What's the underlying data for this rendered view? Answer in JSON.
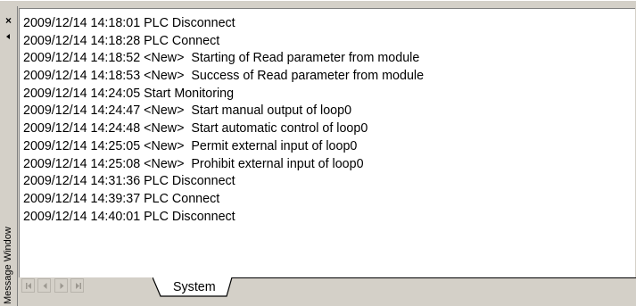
{
  "window": {
    "title": "Message Window",
    "close_glyph": "×"
  },
  "messages": [
    "2009/12/14 14:18:01 PLC Disconnect",
    "2009/12/14 14:18:28 PLC Connect",
    "2009/12/14 14:18:52 <New>  Starting of Read parameter from module",
    "2009/12/14 14:18:53 <New>  Success of Read parameter from module",
    "2009/12/14 14:24:05 Start Monitoring",
    "2009/12/14 14:24:47 <New>  Start manual output of loop0",
    "2009/12/14 14:24:48 <New>  Start automatic control of loop0",
    "2009/12/14 14:25:05 <New>  Permit external input of loop0",
    "2009/12/14 14:25:08 <New>  Prohibit external input of loop0",
    "2009/12/14 14:31:36 PLC Disconnect",
    "2009/12/14 14:39:37 PLC Connect",
    "2009/12/14 14:40:01 PLC Disconnect"
  ],
  "tabs": [
    {
      "label": "System",
      "active": true
    }
  ],
  "icons": {
    "close": "close-icon",
    "pin": "pin-icon",
    "first": "first-tab-icon",
    "prev": "prev-tab-icon",
    "next": "next-tab-icon",
    "last": "last-tab-icon"
  },
  "colors": {
    "panel": "#d4d0c8",
    "pane": "#ffffff",
    "shadow": "#808080",
    "disabled_arrow": "#9c9890"
  }
}
